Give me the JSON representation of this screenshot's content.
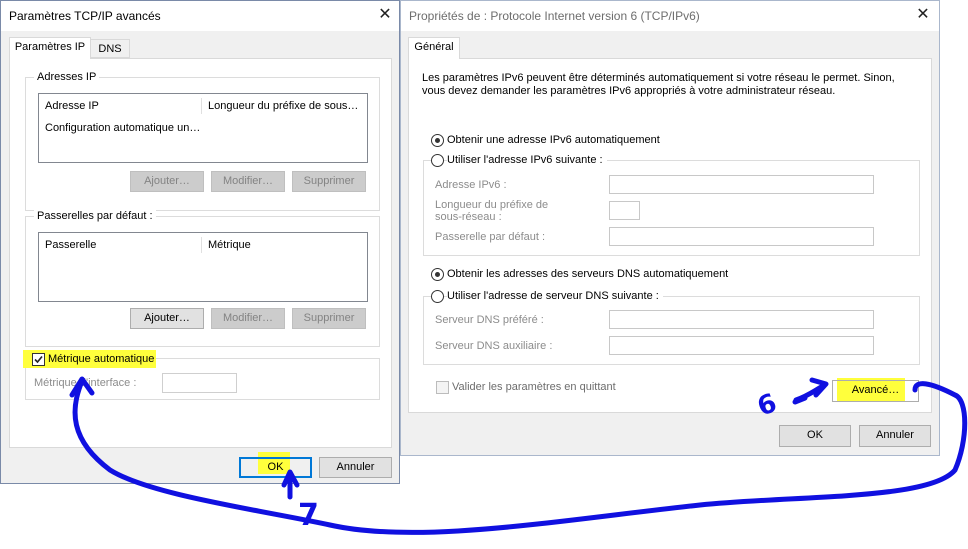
{
  "left_dialog": {
    "title": "Paramètres TCP/IP avancés",
    "tabs": [
      "Paramètres IP",
      "DNS"
    ],
    "ip_group": {
      "label": "Adresses IP",
      "columns": [
        "Adresse IP",
        "Longueur du préfixe de sous…"
      ],
      "rows": [
        [
          "Configuration automatique un…",
          ""
        ]
      ],
      "buttons": {
        "add": "Ajouter…",
        "edit": "Modifier…",
        "remove": "Supprimer"
      }
    },
    "gateway_group": {
      "label": "Passerelles par défaut :",
      "columns": [
        "Passerelle",
        "Métrique"
      ],
      "buttons": {
        "add": "Ajouter…",
        "edit": "Modifier…",
        "remove": "Supprimer"
      }
    },
    "auto_metric": {
      "label": "Métrique automatique",
      "checked": true
    },
    "interface_metric_label": "Métrique d'interface :",
    "ok": "OK",
    "cancel": "Annuler"
  },
  "right_dialog": {
    "title": "Propriétés de : Protocole Internet version 6 (TCP/IPv6)",
    "tab": "Général",
    "description_line1": "Les paramètres IPv6 peuvent être déterminés automatiquement si votre réseau le permet. Sinon,",
    "description_line2": "vous devez demander les paramètres IPv6 appropriés à votre administrateur réseau.",
    "auto_ipv6": "Obtenir une adresse IPv6 automatiquement",
    "manual_ipv6": "Utiliser l'adresse IPv6 suivante :",
    "ipv6_address_label": "Adresse IPv6 :",
    "prefix_label_1": "Longueur du préfixe de",
    "prefix_label_2": "sous-réseau :",
    "gateway_label": "Passerelle par défaut :",
    "auto_dns": "Obtenir les adresses des serveurs DNS automatiquement",
    "manual_dns": "Utiliser l'adresse de serveur DNS suivante :",
    "preferred_dns_label": "Serveur DNS préféré :",
    "alternate_dns_label": "Serveur DNS auxiliaire :",
    "validate_label": "Valider les paramètres en quittant",
    "advanced": "Avancé…",
    "ok": "OK",
    "cancel": "Annuler"
  },
  "annotations": {
    "step6": "6",
    "step7": "7"
  },
  "colors": {
    "highlight": "#ffff3c",
    "annotation": "#1010e0",
    "focus": "#0078d7"
  }
}
